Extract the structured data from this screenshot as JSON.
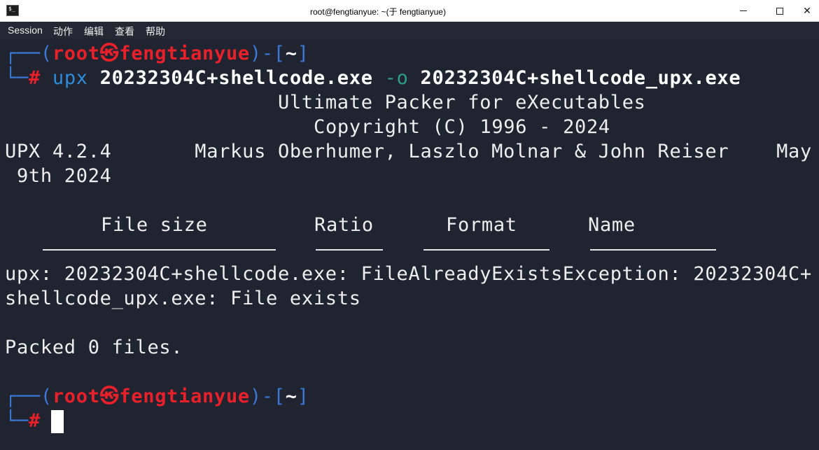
{
  "window": {
    "title": "root@fengtianyue: ~(于 fengtianyue)",
    "icon": "terminal-icon",
    "icon_glyph": "$_"
  },
  "menu": {
    "items": [
      "Session",
      "动作",
      "编辑",
      "查看",
      "帮助"
    ]
  },
  "prompt": {
    "user": "root",
    "host": "fengtianyue",
    "cwd": "~",
    "symbol": "#",
    "at_glyph": "㉿"
  },
  "command": {
    "program": "upx",
    "input_file": "20232304C+shellcode.exe",
    "option": "-o",
    "output_file": "20232304C+shellcode_upx.exe"
  },
  "output": {
    "banner_line1": "Ultimate Packer for eXecutables",
    "banner_line2": "Copyright (C) 1996 - 2024",
    "version_line": "UPX 4.2.4       Markus Oberhumer, Laszlo Molnar & John Reiser    May",
    "date_line": " 9th 2024",
    "table_headers": {
      "file_size": "File size",
      "ratio": "Ratio",
      "format": "Format",
      "name": "Name"
    },
    "error_line1": "upx: 20232304C+shellcode.exe: FileAlreadyExistsException: 20232304C+",
    "error_line2": "shellcode_upx.exe: File exists",
    "summary": "Packed 0 files."
  },
  "colors": {
    "background": "#1f2430",
    "prompt_frame": "#3a78d6",
    "prompt_user": "#e8202a",
    "command": "#2e8bd8",
    "option": "#2e9a8a"
  }
}
